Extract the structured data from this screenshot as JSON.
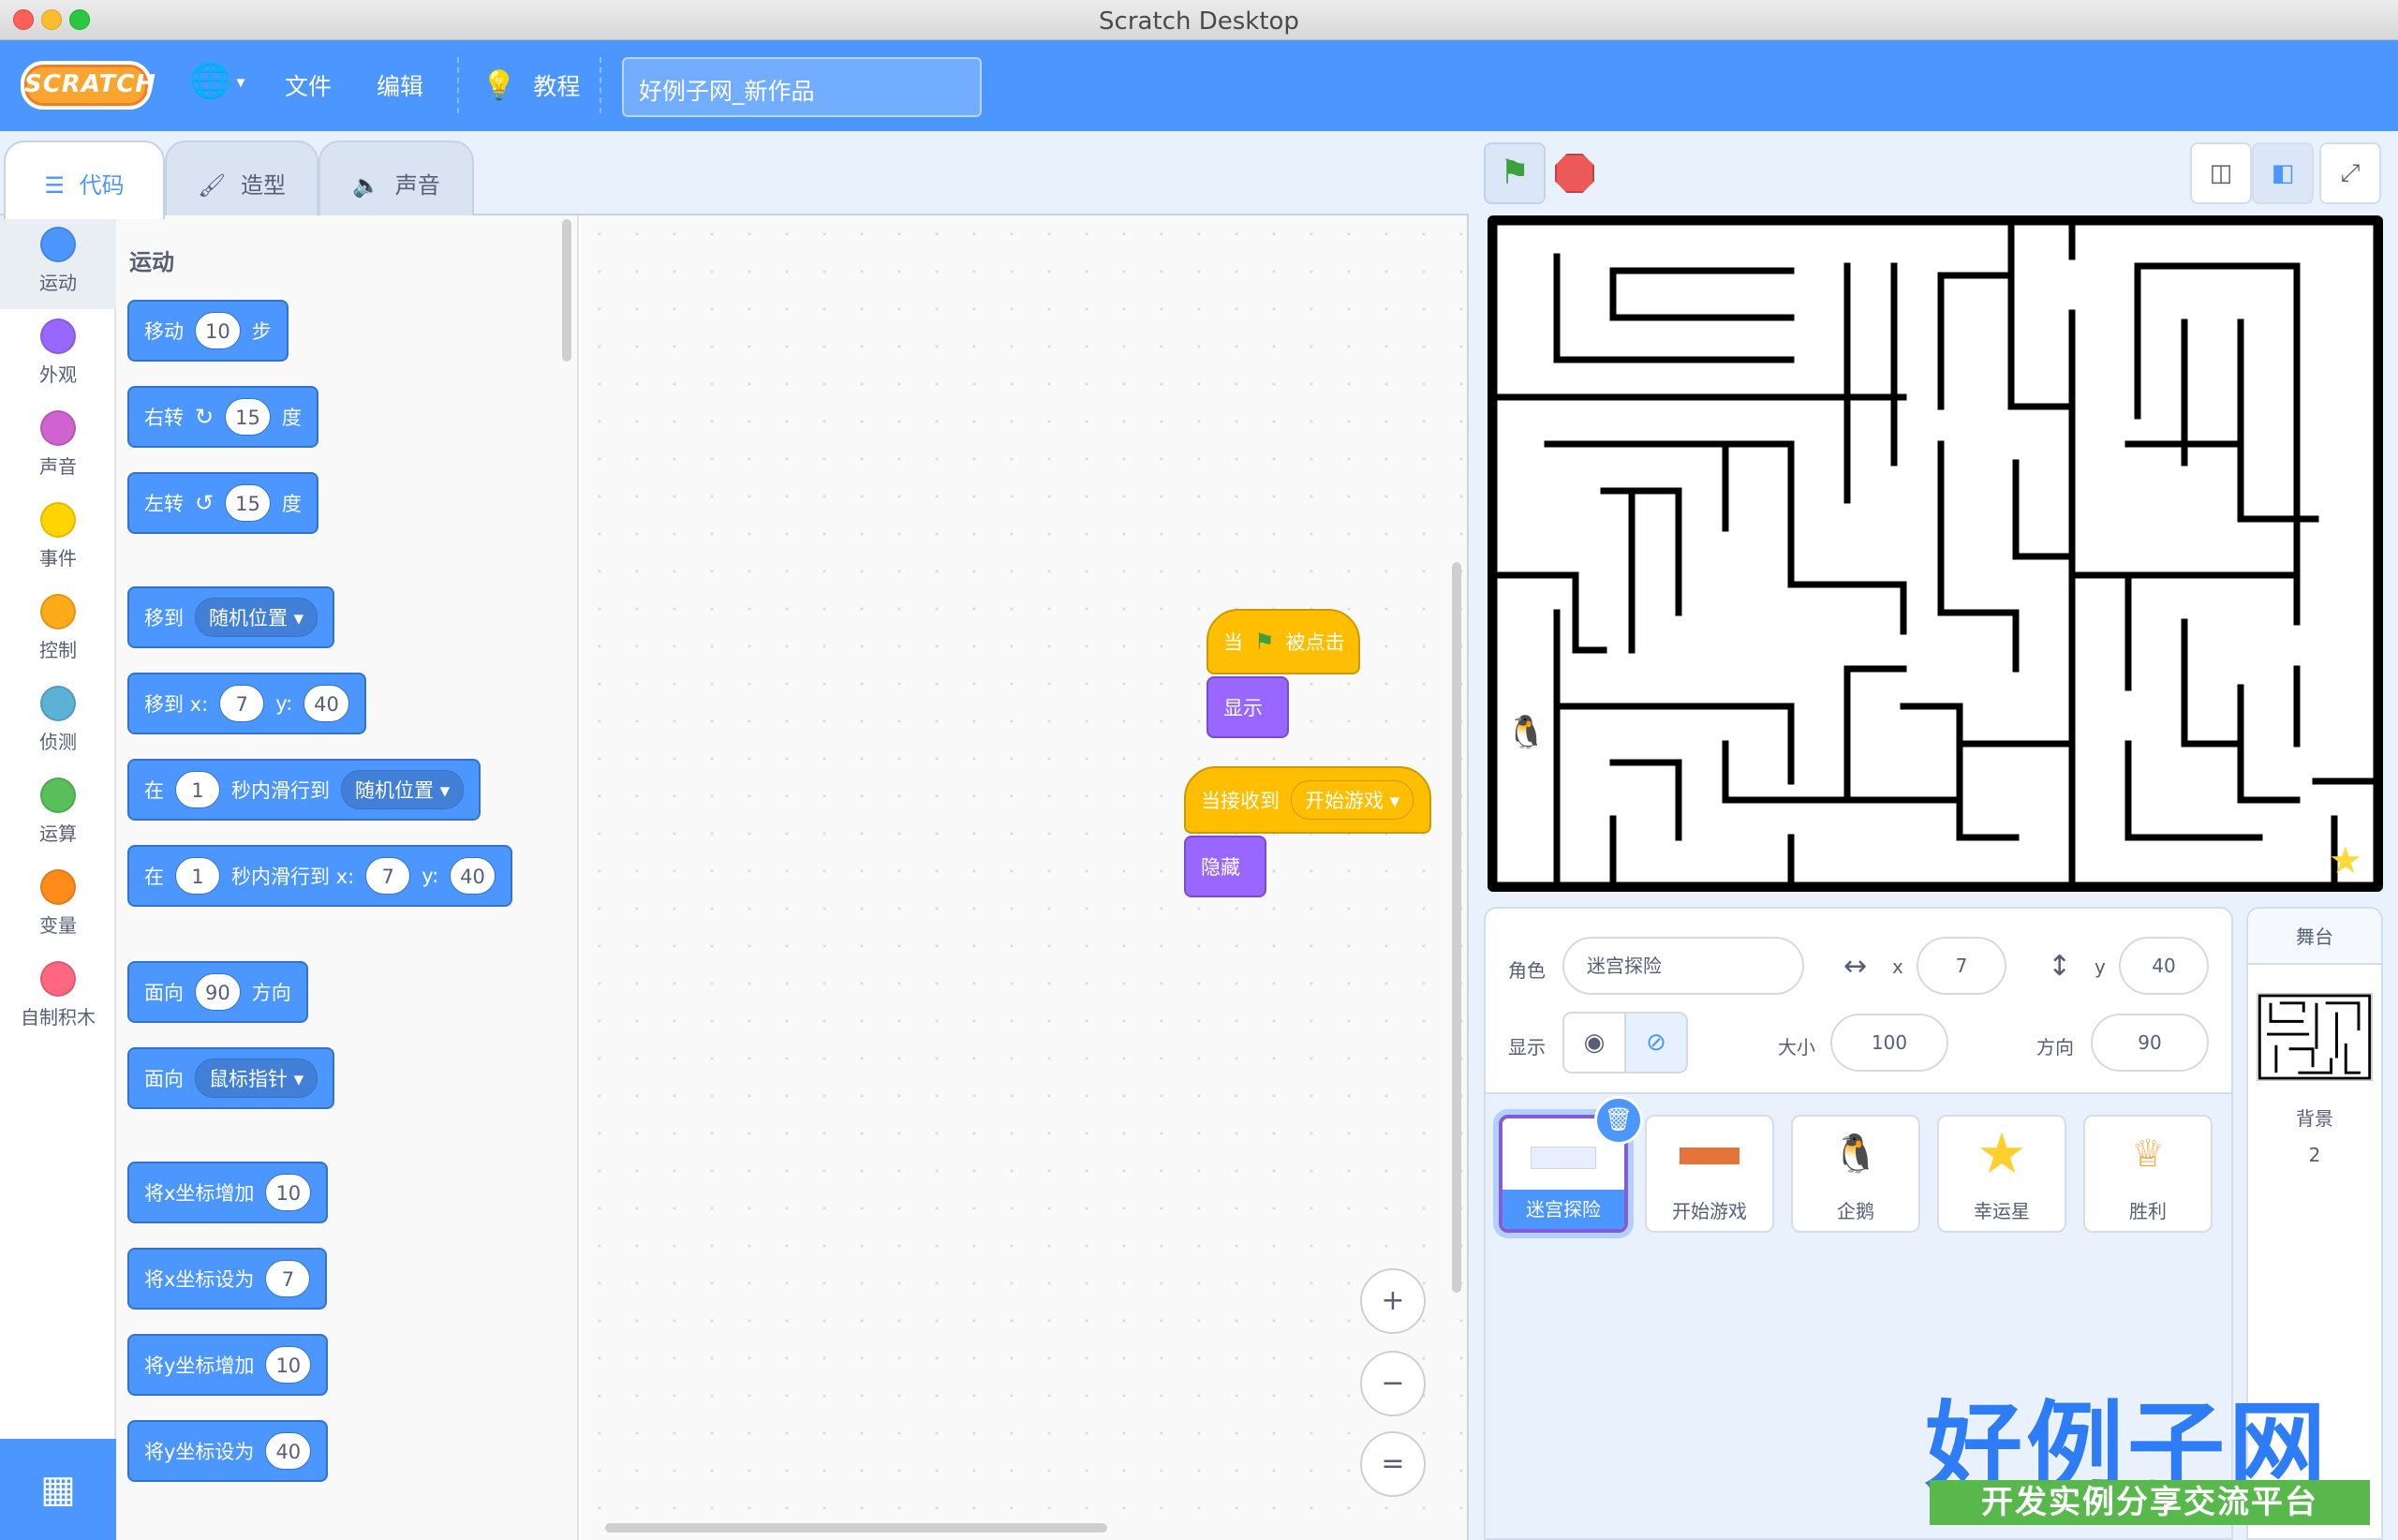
{
  "window": {
    "title": "Scratch Desktop"
  },
  "colors": {
    "motion": "#4c97ff",
    "looks": "#9966ff",
    "sound": "#cf63cf",
    "events": "#ffbf00",
    "control": "#ffab19",
    "sensing": "#5cb1d6",
    "operators": "#59c059",
    "variables": "#ff8c1a",
    "myblocks": "#ff6680"
  },
  "menubar": {
    "logo": "SCRATCH",
    "file": "文件",
    "edit": "编辑",
    "tutorials": "教程",
    "project_title": "好例子网_新作品"
  },
  "tabs": {
    "code": "代码",
    "costumes": "造型",
    "sounds": "声音"
  },
  "categories": [
    {
      "label": "运动",
      "color": "#4c97ff"
    },
    {
      "label": "外观",
      "color": "#9966ff"
    },
    {
      "label": "声音",
      "color": "#cf63cf"
    },
    {
      "label": "事件",
      "color": "#ffd500"
    },
    {
      "label": "控制",
      "color": "#ffab19"
    },
    {
      "label": "侦测",
      "color": "#5cb1d6"
    },
    {
      "label": "运算",
      "color": "#59c059"
    },
    {
      "label": "变量",
      "color": "#ff8c1a"
    },
    {
      "label": "自制积木",
      "color": "#ff6680"
    }
  ],
  "palette": {
    "heading": "运动",
    "move": {
      "a": "移动",
      "n": "10",
      "b": "步"
    },
    "turn_right": {
      "a": "右转",
      "n": "15",
      "b": "度"
    },
    "turn_left": {
      "a": "左转",
      "n": "15",
      "b": "度"
    },
    "goto": {
      "a": "移到",
      "dd": "随机位置"
    },
    "goto_xy": {
      "a": "移到 x:",
      "x": "7",
      "yl": "y:",
      "y": "40"
    },
    "glide": {
      "a": "在",
      "n": "1",
      "b": "秒内滑行到",
      "dd": "随机位置"
    },
    "glide_xy": {
      "a": "在",
      "n": "1",
      "b": "秒内滑行到 x:",
      "x": "7",
      "yl": "y:",
      "y": "40"
    },
    "point_dir": {
      "a": "面向",
      "n": "90",
      "b": "方向"
    },
    "point_to": {
      "a": "面向",
      "dd": "鼠标指针"
    },
    "change_x": {
      "a": "将x坐标增加",
      "n": "10"
    },
    "set_x": {
      "a": "将x坐标设为",
      "n": "7"
    },
    "change_y": {
      "a": "将y坐标增加",
      "n": "10"
    },
    "set_y": {
      "a": "将y坐标设为",
      "n": "40"
    }
  },
  "scripts": {
    "s1_hat_a": "当",
    "s1_hat_b": "被点击",
    "s1_show": "显示",
    "s2_hat": "当接收到",
    "s2_dd": "开始游戏",
    "s2_hide": "隐藏"
  },
  "zoom": {
    "in": "+",
    "out": "−",
    "reset": "="
  },
  "sprite_info": {
    "sprite_label": "角色",
    "sprite_name": "迷宫探险",
    "x_label": "x",
    "x": "7",
    "y_label": "y",
    "y": "40",
    "show_label": "显示",
    "size_label": "大小",
    "size": "100",
    "dir_label": "方向",
    "dir": "90"
  },
  "sprites": [
    {
      "name": "迷宫探险",
      "selected": true
    },
    {
      "name": "开始游戏",
      "selected": false
    },
    {
      "name": "企鹅",
      "selected": false
    },
    {
      "name": "幸运星",
      "selected": false
    },
    {
      "name": "胜利",
      "selected": false
    }
  ],
  "stage_panel": {
    "heading": "舞台",
    "backdrops_label": "背景",
    "backdrops_count": "2"
  },
  "watermark": {
    "main": "好例子网",
    "sub": "开发实例分享交流平台"
  }
}
